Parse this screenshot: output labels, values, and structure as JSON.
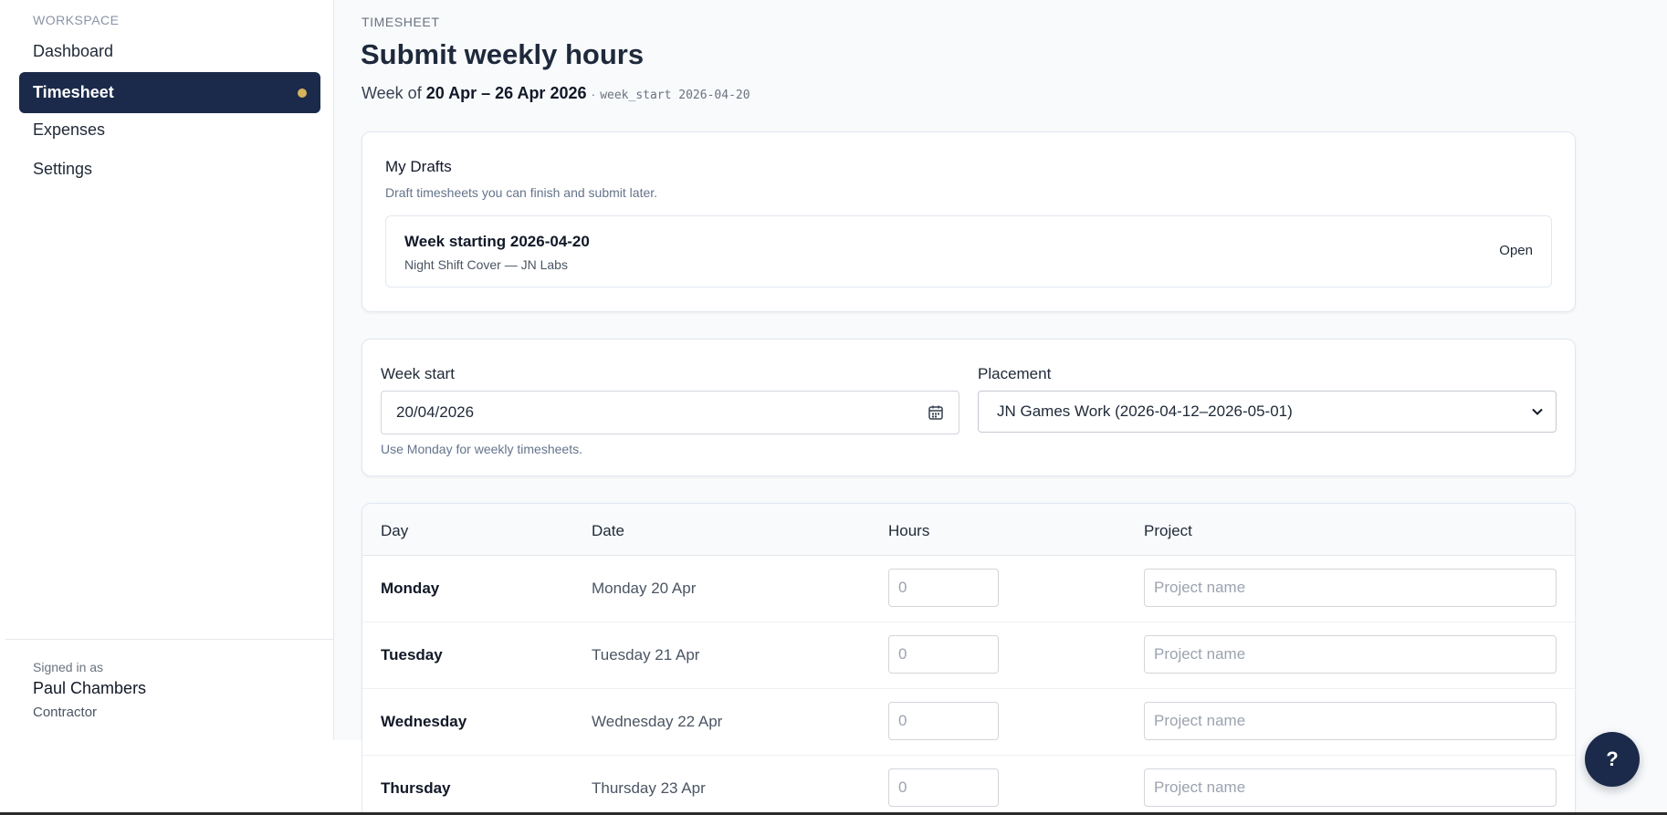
{
  "sidebar": {
    "section_label": "WORKSPACE",
    "items": [
      {
        "label": "Dashboard"
      },
      {
        "label": "Timesheet"
      },
      {
        "label": "Expenses"
      },
      {
        "label": "Settings"
      }
    ],
    "active_index": 1,
    "indicator_color": "#d6b25a",
    "signed_in_label": "Signed in as",
    "user_name": "Paul Chambers",
    "user_role": "Contractor"
  },
  "header": {
    "eyebrow": "TIMESHEET",
    "title": "Submit weekly hours",
    "week_prefix": "Week of",
    "week_range": "20 Apr – 26 Apr 2026",
    "separator": "·",
    "week_start_code": "week_start 2026-04-20"
  },
  "drafts": {
    "title": "My Drafts",
    "subtitle": "Draft timesheets you can finish and submit later.",
    "items": [
      {
        "title": "Week starting 2026-04-20",
        "subtitle": "Night Shift Cover — JN Labs",
        "action": "Open"
      }
    ]
  },
  "form": {
    "week_start_label": "Week start",
    "week_start_value": "20/04/2026",
    "week_start_hint": "Use Monday for weekly timesheets.",
    "placement_label": "Placement",
    "placement_value": "JN Games Work (2026-04-12–2026-05-01)"
  },
  "table": {
    "headers": {
      "day": "Day",
      "date": "Date",
      "hours": "Hours",
      "project": "Project"
    },
    "hours_placeholder": "0",
    "project_placeholder": "Project name",
    "rows": [
      {
        "day": "Monday",
        "date": "Monday 20 Apr"
      },
      {
        "day": "Tuesday",
        "date": "Tuesday 21 Apr"
      },
      {
        "day": "Wednesday",
        "date": "Wednesday 22 Apr"
      },
      {
        "day": "Thursday",
        "date": "Thursday 23 Apr"
      }
    ]
  },
  "help": {
    "label": "?"
  },
  "colors": {
    "primary": "#1b2a4a",
    "accent": "#d6b25a",
    "background": "#f8fafc"
  }
}
